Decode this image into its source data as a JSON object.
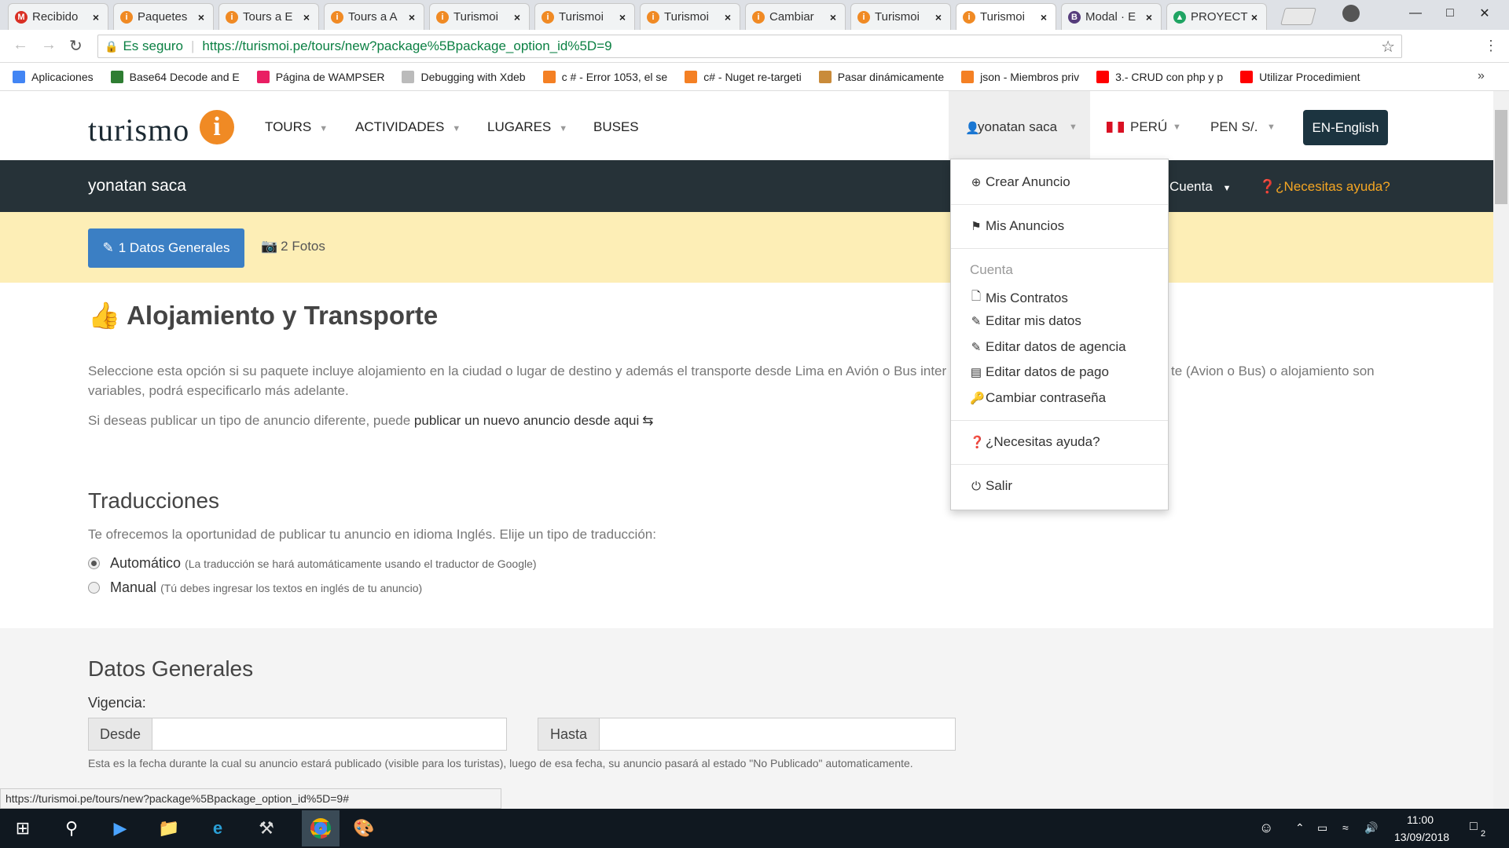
{
  "browser": {
    "tabs": [
      {
        "label": "Recibido",
        "fav": "M",
        "color": "#d93025"
      },
      {
        "label": "Paquetes",
        "fav": "i",
        "color": "#f08a24"
      },
      {
        "label": "Tours a E",
        "fav": "i",
        "color": "#f08a24"
      },
      {
        "label": "Tours a A",
        "fav": "i",
        "color": "#f08a24"
      },
      {
        "label": "Turismoi",
        "fav": "i",
        "color": "#f08a24"
      },
      {
        "label": "Turismoi",
        "fav": "i",
        "color": "#f08a24"
      },
      {
        "label": "Turismoi",
        "fav": "i",
        "color": "#f08a24"
      },
      {
        "label": "Cambiar",
        "fav": "i",
        "color": "#f08a24"
      },
      {
        "label": "Turismoi",
        "fav": "i",
        "color": "#f08a24"
      },
      {
        "label": "Turismoi",
        "fav": "i",
        "color": "#f08a24",
        "active": true
      },
      {
        "label": "Modal · E",
        "fav": "B",
        "color": "#563d7c"
      },
      {
        "label": "PROYECT",
        "fav": "▲",
        "color": "#1fa463"
      }
    ],
    "close_glyph": "×",
    "secure_label": "Es seguro",
    "url": "https://turismoi.pe/tours/new?package%5Bpackage_option_id%5D=9",
    "bookmarks": [
      {
        "label": "Aplicaciones",
        "color": "#4285f4"
      },
      {
        "label": "Base64 Decode and E",
        "color": "#2e7d32"
      },
      {
        "label": "Página de WAMPSER",
        "color": "#e91e63"
      },
      {
        "label": "Debugging with Xdeb",
        "color": "#bbbbbb"
      },
      {
        "label": "c # - Error 1053, el se",
        "color": "#f48024"
      },
      {
        "label": "c# - Nuget re-targeti",
        "color": "#f48024"
      },
      {
        "label": "Pasar dinámicamente",
        "color": "#c98b3a"
      },
      {
        "label": "json - Miembros priv",
        "color": "#f48024"
      },
      {
        "label": "3.- CRUD con php y p",
        "color": "#ff0000"
      },
      {
        "label": "Utilizar Procedimient",
        "color": "#ff0000"
      }
    ],
    "status_url": "https://turismoi.pe/tours/new?package%5Bpackage_option_id%5D=9#"
  },
  "site": {
    "logo_text": "turismo",
    "logo_i": "i",
    "nav": [
      {
        "label": "TOURS",
        "caret": true
      },
      {
        "label": "ACTIVIDADES",
        "caret": true
      },
      {
        "label": "LUGARES",
        "caret": true
      },
      {
        "label": "BUSES",
        "caret": false
      }
    ],
    "user_name": "yonatan saca",
    "country": "PERÚ",
    "currency": "PEN S/.",
    "language_button": "EN-English",
    "subbar_name": "yonatan saca",
    "subbar_cuenta": "Cuenta",
    "subbar_help": "¿Necesitas ayuda?",
    "step1_label": "1 Datos Generales",
    "step2_label": "2 Fotos"
  },
  "dropdown": {
    "crear": "Crear Anuncio",
    "mis_anuncios": "Mis Anuncios",
    "cuenta_header": "Cuenta",
    "mis_contratos": "Mis Contratos",
    "editar_datos": "Editar mis datos",
    "editar_agencia": "Editar datos de agencia",
    "editar_pago": "Editar datos de pago",
    "cambiar_pass": "Cambiar contraseña",
    "ayuda": "¿Necesitas ayuda?",
    "salir": "Salir"
  },
  "content": {
    "title": "Alojamiento y Transporte",
    "desc_line1": "Seleccione esta opción si su paquete incluye alojamiento en la ciudad o lugar de destino y además el transporte desde Lima en Avión o Bus inter",
    "desc_line1_tail": "te (Avion o Bus) o alojamiento son",
    "desc_line2": "variables, podrá especificarlo más adelante.",
    "other_prefix": "Si deseas publicar un tipo de anuncio diferente, puede ",
    "other_link": "publicar un nuevo anuncio desde aqui",
    "translations_title": "Traducciones",
    "translations_desc": "Te ofrecemos la oportunidad de publicar tu anuncio en idioma Inglés. Elije un tipo de traducción:",
    "radio_auto": "Automático",
    "radio_auto_note": "(La traducción se hará automáticamente usando el traductor de Google)",
    "radio_manual": "Manual",
    "radio_manual_note": "(Tú debes ingresar los textos en inglés de tu anuncio)",
    "general_title": "Datos Generales",
    "vigencia_label": "Vigencia:",
    "desde_label": "Desde",
    "hasta_label": "Hasta",
    "desde_value": "",
    "hasta_value": "",
    "vigencia_help": "Esta es la fecha durante la cual su anuncio estará publicado (visible para los turistas), luego de esa fecha, su anuncio pasará al estado \"No Publicado\" automaticamente."
  },
  "taskbar": {
    "time": "11:00",
    "date": "13/09/2018",
    "notifications": "2"
  }
}
